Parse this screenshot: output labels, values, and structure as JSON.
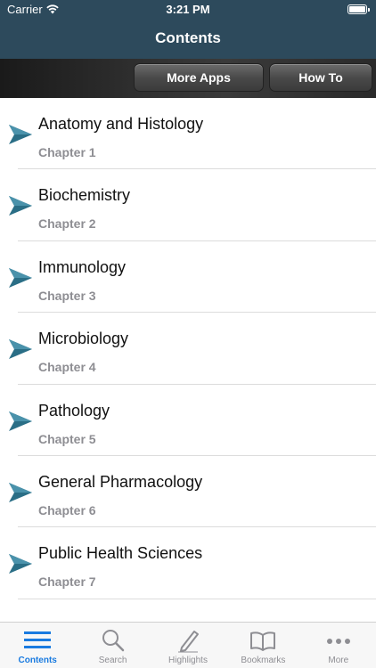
{
  "status_bar": {
    "carrier": "Carrier",
    "time": "3:21 PM"
  },
  "nav": {
    "title": "Contents"
  },
  "toolbar": {
    "more_apps_label": "More Apps",
    "how_to_label": "How To"
  },
  "chapters": [
    {
      "title": "Anatomy and Histology",
      "subtitle": "Chapter 1"
    },
    {
      "title": "Biochemistry",
      "subtitle": "Chapter 2"
    },
    {
      "title": "Immunology",
      "subtitle": "Chapter 3"
    },
    {
      "title": "Microbiology",
      "subtitle": "Chapter 4"
    },
    {
      "title": "Pathology",
      "subtitle": "Chapter 5"
    },
    {
      "title": "General Pharmacology",
      "subtitle": "Chapter 6"
    },
    {
      "title": "Public Health Sciences",
      "subtitle": "Chapter 7"
    }
  ],
  "tabs": [
    {
      "label": "Contents",
      "icon": "list-icon",
      "active": true
    },
    {
      "label": "Search",
      "icon": "search-icon",
      "active": false
    },
    {
      "label": "Highlights",
      "icon": "pencil-icon",
      "active": false
    },
    {
      "label": "Bookmarks",
      "icon": "book-icon",
      "active": false
    },
    {
      "label": "More",
      "icon": "more-icon",
      "active": false
    }
  ],
  "colors": {
    "nav_background": "#2d4a5c",
    "arrow": "#2a6e86",
    "tab_active": "#1a7be0",
    "tab_inactive": "#8e8e93"
  }
}
